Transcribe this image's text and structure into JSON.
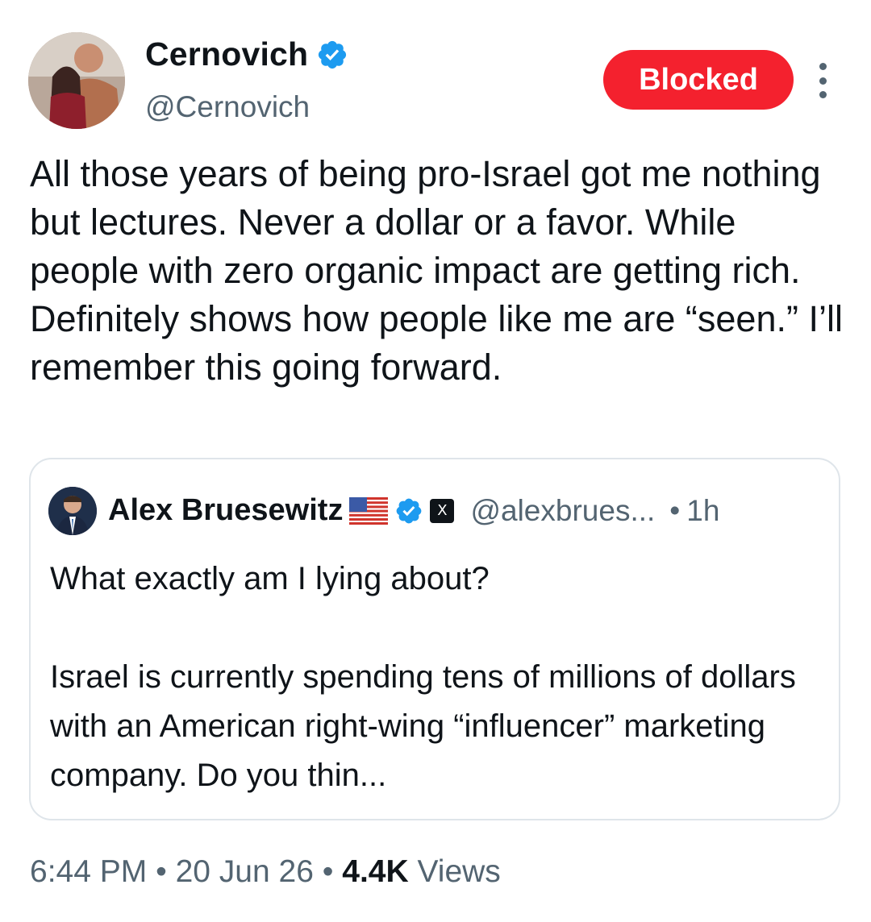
{
  "author": {
    "name": "Cernovich",
    "handle": "@Cernovich",
    "verified": true,
    "avatar_icon": "profile-photo"
  },
  "actions": {
    "blocked_label": "Blocked",
    "more_icon": "more-vertical-icon"
  },
  "tweet": {
    "text": "All those years of being pro-Israel got me nothing but lectures. Never a dollar or a favor. While people with zero organic impact are getting rich. Definitely shows how people like me are “seen.” I’ll remember this going forward."
  },
  "quote": {
    "name": "Alex Bruesewitz",
    "flag_icon": "us-flag-icon",
    "verified": true,
    "affiliate_badge": "X",
    "handle": "@alexbrues...",
    "separator": "•",
    "time": "1h",
    "text": "What exactly am I lying about?\n\nIsrael is currently spending tens of millions of dollars with an American right-wing “influencer” marketing company. Do you thin..."
  },
  "meta": {
    "time": "6:44 PM",
    "sep1": "•",
    "date": "20 Jun 26",
    "sep2": "•",
    "views_count": "4.4K",
    "views_label": "Views"
  },
  "colors": {
    "blocked_red": "#f4212e",
    "verified_blue": "#1d9bf0",
    "secondary_text": "#536471",
    "border": "#dfe5ea"
  }
}
